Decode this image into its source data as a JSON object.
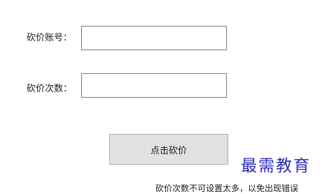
{
  "form": {
    "account_label": "砍价账号：",
    "account_value": "",
    "count_label": "砍价次数：",
    "count_value": ""
  },
  "action": {
    "button_label": "点击砍价"
  },
  "watermark": {
    "text": "最需教育"
  },
  "footer": {
    "note": "砍价次数不可设置太多，以免出现错误"
  }
}
